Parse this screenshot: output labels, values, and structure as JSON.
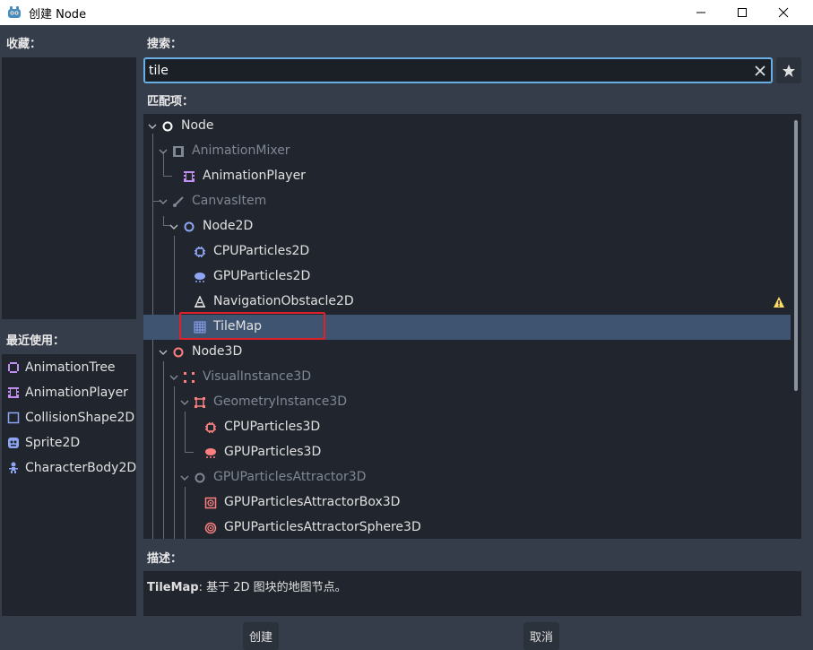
{
  "window": {
    "title": "创建 Node"
  },
  "favorites": {
    "label": "收藏："
  },
  "recent": {
    "label": "最近使用：",
    "items": [
      {
        "label": "AnimationTree",
        "icon": "animation-tree-icon"
      },
      {
        "label": "AnimationPlayer",
        "icon": "animation-player-icon"
      },
      {
        "label": "CollisionShape2D",
        "icon": "collision-shape-icon"
      },
      {
        "label": "Sprite2D",
        "icon": "sprite-icon"
      },
      {
        "label": "CharacterBody2D",
        "icon": "character-body-icon"
      }
    ]
  },
  "search": {
    "label": "搜索：",
    "value": "tile"
  },
  "matches": {
    "label": "匹配项：",
    "items": [
      {
        "label": "Node",
        "dim": false,
        "icon": "node-circle-white-icon"
      },
      {
        "label": "AnimationMixer",
        "dim": true,
        "icon": "animation-mixer-icon"
      },
      {
        "label": "AnimationPlayer",
        "dim": false,
        "icon": "animation-player-icon"
      },
      {
        "label": "CanvasItem",
        "dim": true,
        "icon": "brush-icon"
      },
      {
        "label": "Node2D",
        "dim": false,
        "icon": "node2d-circle-icon"
      },
      {
        "label": "CPUParticles2D",
        "dim": false,
        "icon": "cpu-particles-2d-icon"
      },
      {
        "label": "GPUParticles2D",
        "dim": false,
        "icon": "gpu-particles-2d-icon"
      },
      {
        "label": "NavigationObstacle2D",
        "dim": false,
        "icon": "navigation-obstacle-icon"
      },
      {
        "label": "TileMap",
        "dim": false,
        "icon": "tilemap-grid-icon"
      },
      {
        "label": "Node3D",
        "dim": false,
        "icon": "node3d-circle-icon"
      },
      {
        "label": "VisualInstance3D",
        "dim": true,
        "icon": "visual-instance-icon"
      },
      {
        "label": "GeometryInstance3D",
        "dim": true,
        "icon": "geometry-instance-icon"
      },
      {
        "label": "CPUParticles3D",
        "dim": false,
        "icon": "cpu-particles-3d-icon"
      },
      {
        "label": "GPUParticles3D",
        "dim": false,
        "icon": "gpu-particles-3d-icon"
      },
      {
        "label": "GPUParticlesAttractor3D",
        "dim": true,
        "icon": "attractor-icon"
      },
      {
        "label": "GPUParticlesAttractorBox3D",
        "dim": false,
        "icon": "attractor-box-icon"
      },
      {
        "label": "GPUParticlesAttractorSphere3D",
        "dim": false,
        "icon": "attractor-sphere-icon"
      }
    ]
  },
  "description": {
    "label": "描述：",
    "name": "TileMap",
    "text": ": 基于 2D 图块的地图节点。"
  },
  "buttons": {
    "create": "创建",
    "cancel": "取消"
  },
  "colors": {
    "accent": "#69aee5",
    "selection": "#3f5470",
    "highlight": "#e0202a",
    "node2d": "#8da5f3",
    "node3d": "#fc7f7f",
    "purple": "#c38ef1"
  }
}
